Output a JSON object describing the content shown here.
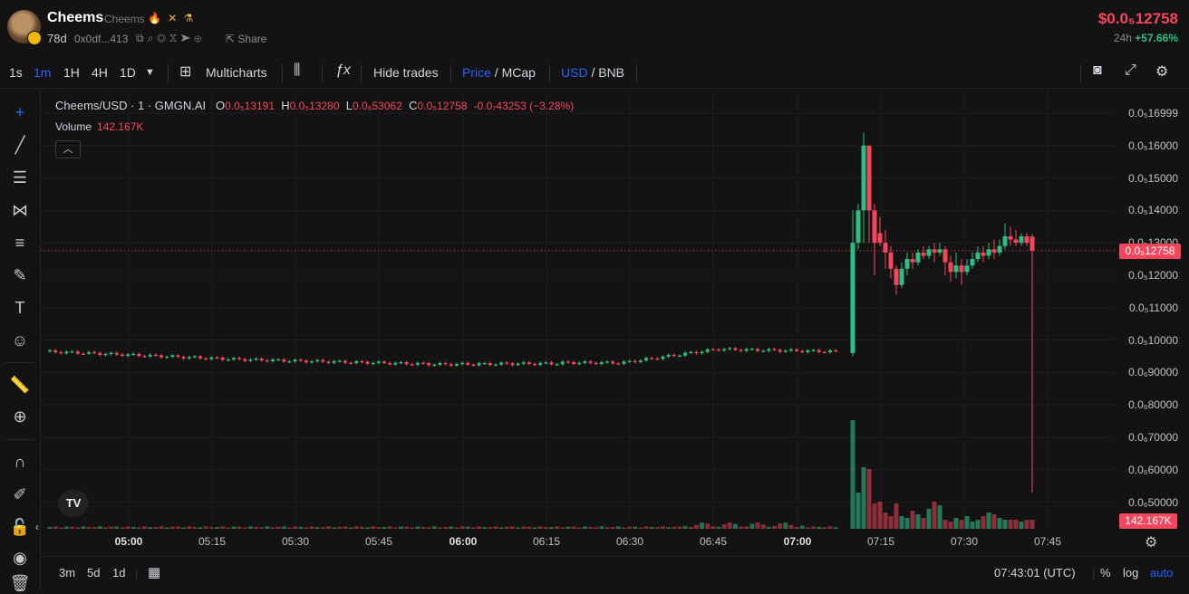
{
  "token": {
    "name": "Cheems",
    "symbol_sub": "Cheems",
    "badges": "🔥 ✕ ⚗",
    "age": "78d",
    "address": "0x0df...413",
    "share_label": "Share",
    "price": "$0.0₅12758",
    "change_label": "24h",
    "change_value": "+57.66%"
  },
  "toolbar": {
    "intervals": [
      "1s",
      "1m",
      "1H",
      "4H",
      "1D"
    ],
    "active_interval": "1m",
    "multicharts": "Multicharts",
    "hide_trades": "Hide trades",
    "price_label": "Price",
    "mcap_label": "MCap",
    "usd_label": "USD",
    "bnb_label": "BNB",
    "slash": " / "
  },
  "legend": {
    "pair": "Cheems/USD · 1 · GMGN.AI",
    "o_label": "O",
    "o_value": "0.0₅13191",
    "h_label": "H",
    "h_value": "0.0₅13280",
    "l_label": "L",
    "l_value": "0.0₆53062",
    "c_label": "C",
    "c_value": "0.0₅12758",
    "change": "-0.0₇43253 (−3.28%)",
    "volume_label": "Volume",
    "volume_value": "142.167K"
  },
  "price_axis": [
    "0.0₅16999",
    "0.0₅16000",
    "0.0₅15000",
    "0.0₅14000",
    "0.0₅13000",
    "0.0₅12000",
    "0.0₅11000",
    "0.0₅10000",
    "0.0₆90000",
    "0.0₆80000",
    "0.0₆70000",
    "0.0₆60000",
    "0.0₆50000"
  ],
  "time_axis": [
    "05:00",
    "05:15",
    "05:30",
    "05:45",
    "06:00",
    "06:15",
    "06:30",
    "06:45",
    "07:00",
    "07:15",
    "07:30",
    "07:45"
  ],
  "current_price_tag": "0.0₅12758",
  "volume_tag": "142.167K",
  "bottom": {
    "ranges": [
      "3m",
      "5d",
      "1d"
    ],
    "clock": "07:43:01 (UTC)",
    "percent": "%",
    "log": "log",
    "auto": "auto"
  },
  "icons": {
    "left_tools": [
      "crosshair-icon",
      "trendline-icon",
      "fib-icon",
      "pattern-icon",
      "gann-icon",
      "brush-icon",
      "text-icon",
      "emoji-icon",
      "ruler-icon",
      "zoom-icon",
      "magnet-icon",
      "lock-drawing-icon",
      "lock-icon",
      "eye-icon"
    ]
  },
  "colors": {
    "up": "#2ebd85",
    "down": "#f6465d",
    "accent": "#2962ff",
    "background": "#131313"
  },
  "chart_data": {
    "type": "candlestick",
    "pair": "Cheems/USD",
    "interval": "1m",
    "x_range": [
      "04:46",
      "07:45"
    ],
    "y_unit": "USD",
    "ylim": [
      4.5e-07,
      1.7e-06
    ],
    "current_price": 1.2758e-06,
    "series": [
      {
        "segment": "04:46-07:08",
        "price_approx": 9.4e-07,
        "trend": "flat, slight dip to 0.00000092 then recover to 0.00000097"
      },
      {
        "time": "07:09",
        "open": 9.6e-07,
        "close": 1.3e-06,
        "high": 1.4e-06,
        "low": 9.5e-07
      },
      {
        "time": "07:10",
        "open": 1.4e-06,
        "close": 1.6e-06,
        "high": 1.6399e-06,
        "low": 1.3e-06
      },
      {
        "time": "07:11",
        "open": 1.6e-06,
        "close": 1.4e-06,
        "high": 1.6e-06,
        "low": 1.3e-06
      },
      {
        "time": "07:12",
        "open": 1.4e-06,
        "close": 1.3e-06,
        "high": 1.4e-06,
        "low": 1.2e-06
      },
      {
        "time": "07:15-07:40",
        "range": [
          1.15e-06,
          1.3e-06
        ],
        "trend": "choppy sideways"
      },
      {
        "time": "07:43",
        "open": 1.3191e-06,
        "high": 1.328e-06,
        "low": 5.3062e-07,
        "close": 1.2758e-06
      }
    ],
    "volume": {
      "last": "142.167K",
      "spike_time": "07:09"
    }
  }
}
